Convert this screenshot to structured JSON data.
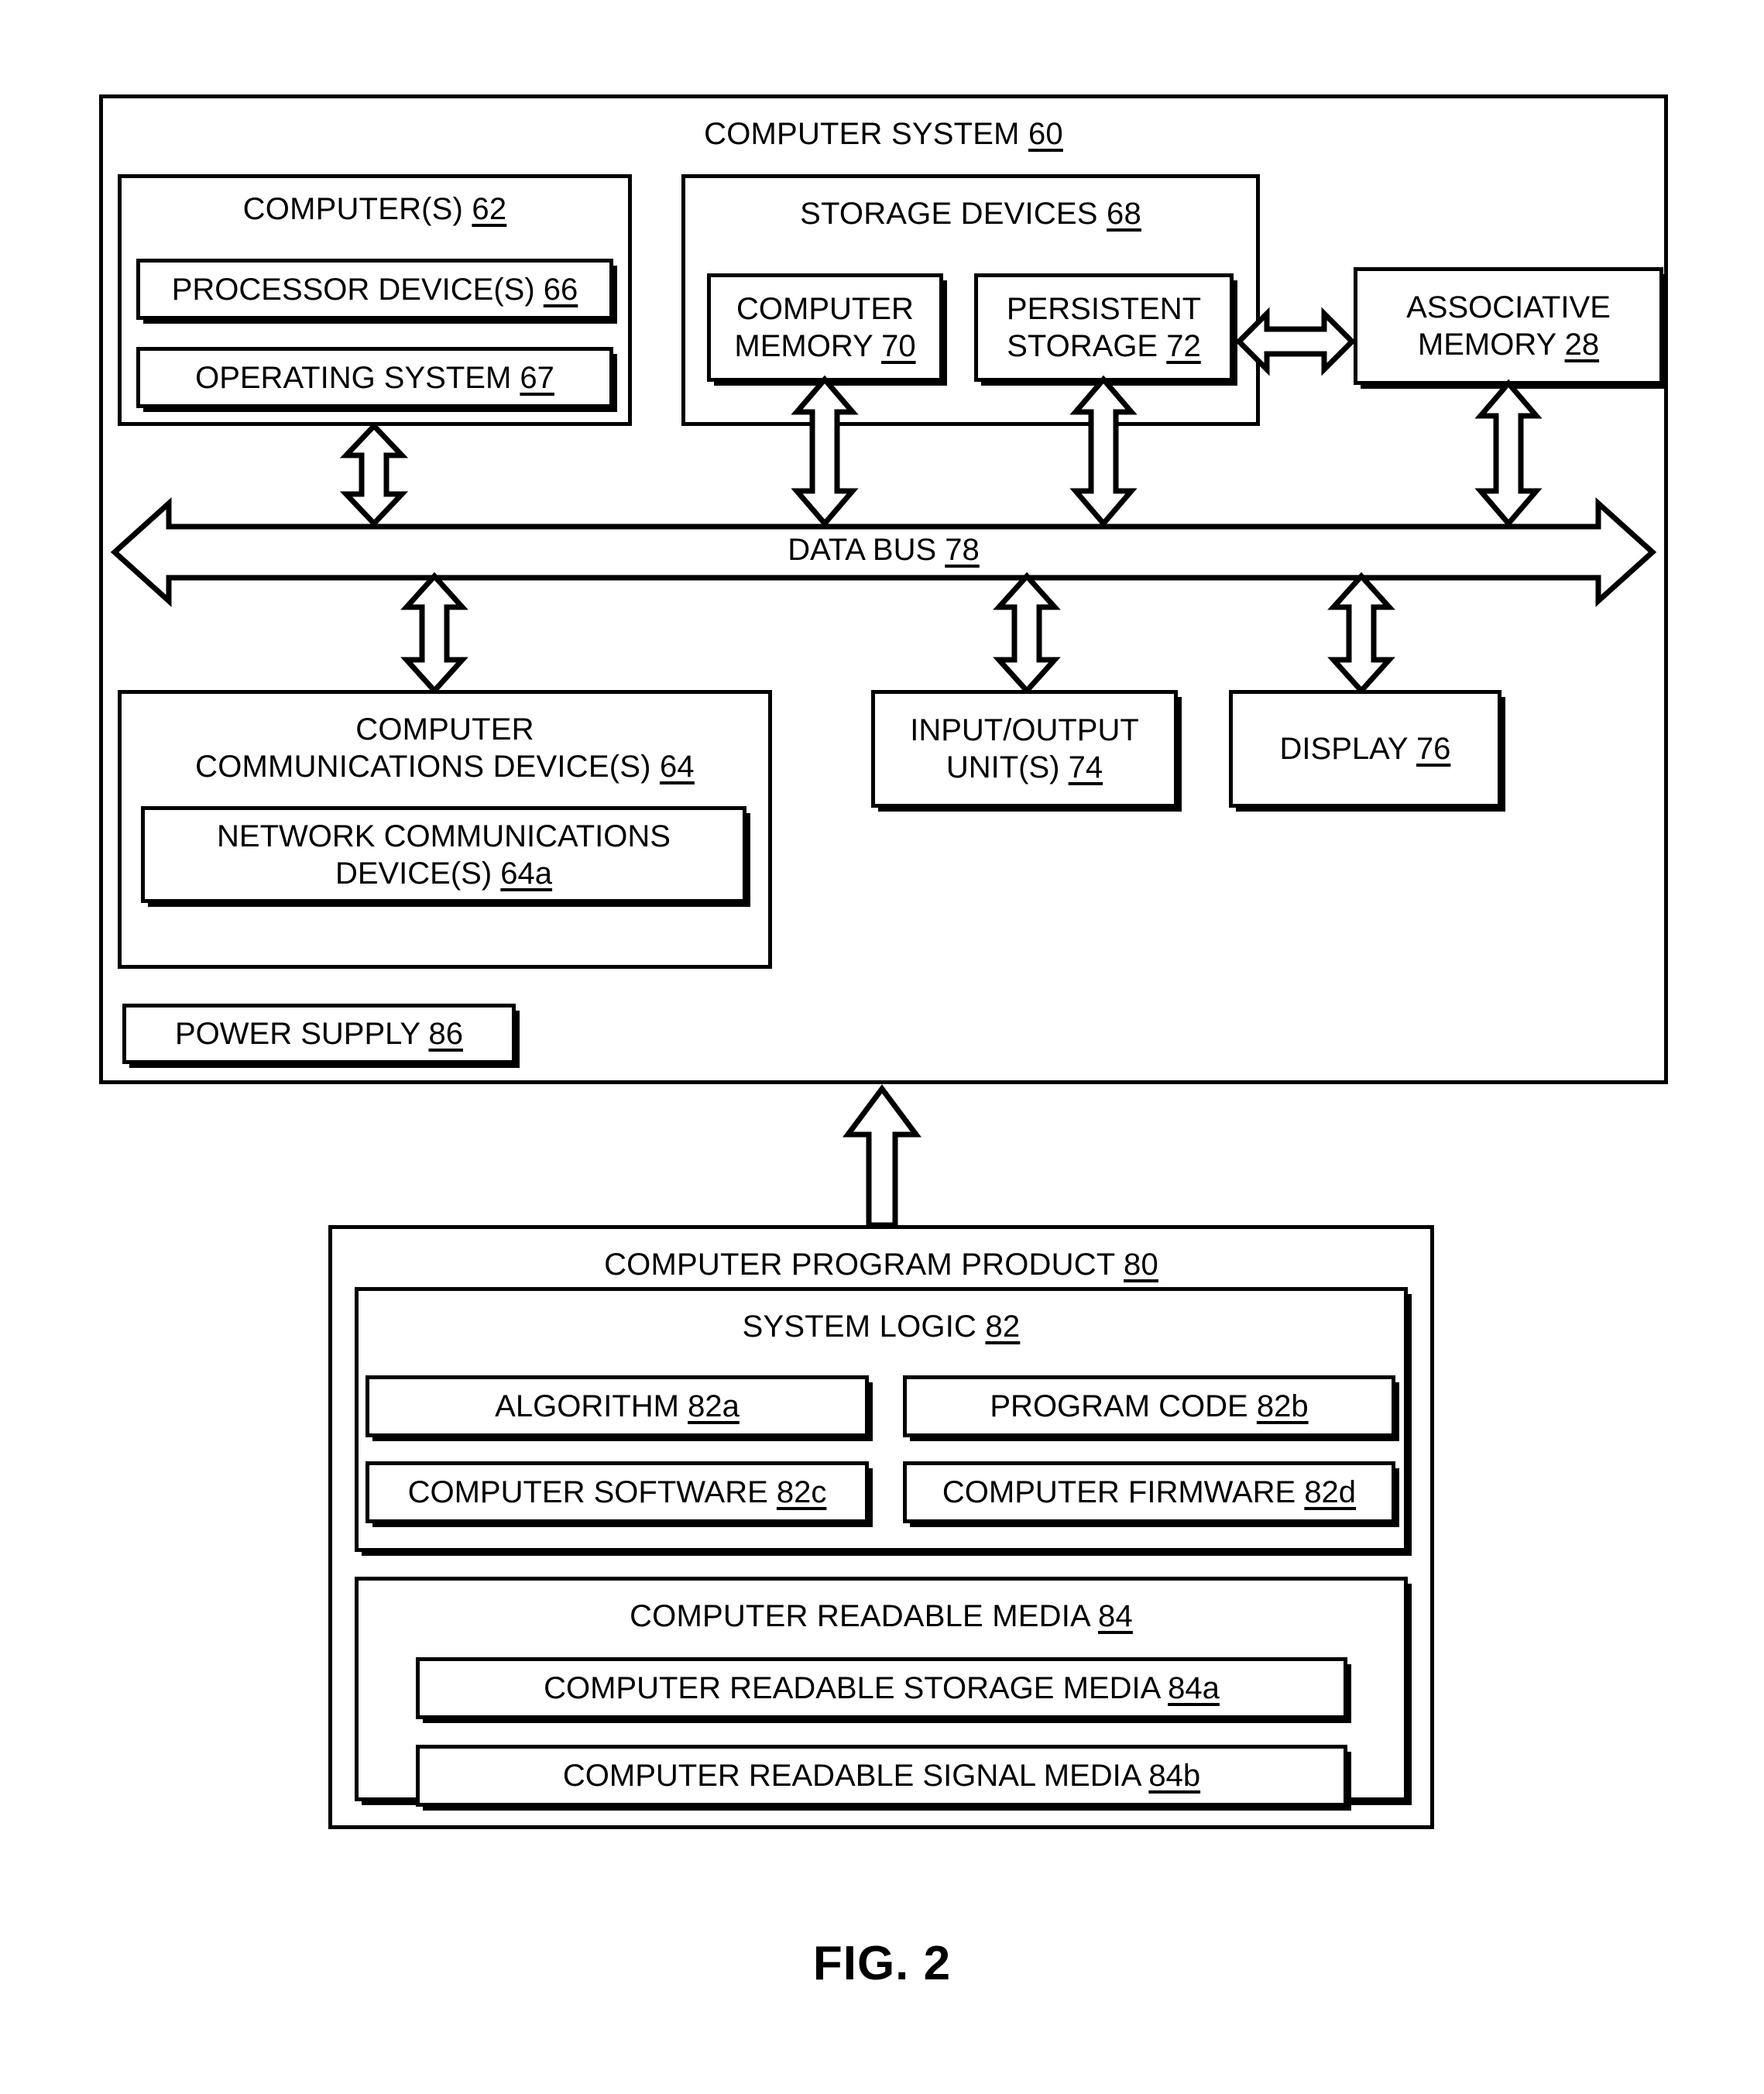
{
  "figure": {
    "caption": "FIG. 2"
  },
  "computer_system": {
    "title_text": "COMPUTER SYSTEM ",
    "title_ref": "60",
    "computers": {
      "title_text": "COMPUTER(S) ",
      "title_ref": "62",
      "processor_devices": {
        "text": "PROCESSOR DEVICE(S) ",
        "ref": "66"
      },
      "operating_system": {
        "text": "OPERATING SYSTEM ",
        "ref": "67"
      }
    },
    "storage_devices": {
      "title_text": "STORAGE DEVICES ",
      "title_ref": "68",
      "computer_memory": {
        "line1": "COMPUTER",
        "line2": "MEMORY ",
        "ref": "70"
      },
      "persistent_storage": {
        "line1": "PERSISTENT",
        "line2": "STORAGE ",
        "ref": "72"
      }
    },
    "associative_memory": {
      "line1": "ASSOCIATIVE",
      "line2": "MEMORY ",
      "ref": "28"
    },
    "data_bus": {
      "text": "DATA BUS ",
      "ref": "78"
    },
    "comm_devices": {
      "line1": "COMPUTER",
      "line2": "COMMUNICATIONS DEVICE(S) ",
      "ref": "64",
      "network_comm_devices": {
        "line1": "NETWORK COMMUNICATIONS",
        "line2": "DEVICE(S) ",
        "ref": "64a"
      }
    },
    "io_units": {
      "line1": "INPUT/OUTPUT",
      "line2": "UNIT(S) ",
      "ref": "74"
    },
    "display": {
      "text": "DISPLAY ",
      "ref": "76"
    },
    "power_supply": {
      "text": "POWER SUPPLY ",
      "ref": "86"
    }
  },
  "computer_program_product": {
    "title_text": "COMPUTER PROGRAM PRODUCT ",
    "title_ref": "80",
    "system_logic": {
      "title_text": "SYSTEM LOGIC ",
      "title_ref": "82",
      "algorithm": {
        "text": "ALGORITHM ",
        "ref": "82a"
      },
      "program_code": {
        "text": "PROGRAM CODE ",
        "ref": "82b"
      },
      "computer_software": {
        "text": "COMPUTER SOFTWARE ",
        "ref": "82c"
      },
      "computer_firmware": {
        "text": "COMPUTER FIRMWARE ",
        "ref": "82d"
      }
    },
    "computer_readable_media": {
      "title_text": "COMPUTER READABLE MEDIA ",
      "title_ref": "84",
      "storage_media": {
        "text": "COMPUTER READABLE STORAGE MEDIA ",
        "ref": "84a"
      },
      "signal_media": {
        "text": "COMPUTER READABLE SIGNAL MEDIA ",
        "ref": "84b"
      }
    }
  },
  "colors": {
    "stroke": "#000000",
    "background": "#ffffff"
  }
}
